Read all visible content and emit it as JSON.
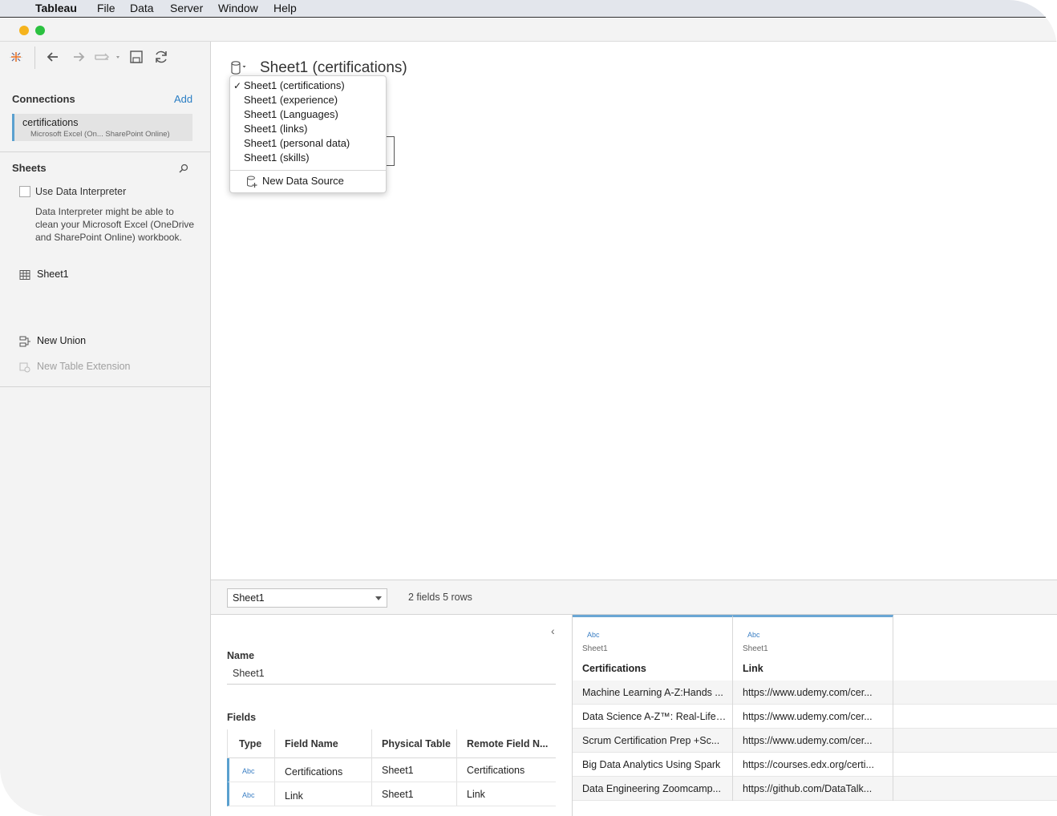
{
  "menubar": {
    "app_name": "Tableau",
    "items": [
      "File",
      "Data",
      "Server",
      "Window",
      "Help"
    ]
  },
  "colors": {
    "accent": "#5aa0cf",
    "link": "#2a7ec4",
    "traffic_yellow": "#f5b31d",
    "traffic_green": "#2bc140"
  },
  "left": {
    "toolbar_icons": [
      "tableau-logo-icon",
      "back-arrow-icon",
      "forward-arrow-icon",
      "redo-icon",
      "save-icon",
      "refresh-icon"
    ],
    "connections_title": "Connections",
    "add_label": "Add",
    "connection": {
      "name": "certifications",
      "type": "Microsoft Excel (On... SharePoint Online)"
    },
    "sheets_title": "Sheets",
    "interpreter_label": "Use Data Interpreter",
    "interpreter_desc": "Data Interpreter might be able to clean your Microsoft Excel (OneDrive and SharePoint Online) workbook.",
    "sheet_name": "Sheet1",
    "new_union": "New Union",
    "new_table_extension": "New Table Extension"
  },
  "canvas": {
    "title": "Sheet1 (certifications)"
  },
  "dropdown": {
    "items": [
      "Sheet1 (certifications)",
      "Sheet1 (experience)",
      "Sheet1 (Languages)",
      "Sheet1 (links)",
      "Sheet1 (personal data)",
      "Sheet1 (skills)"
    ],
    "selected_index": 0,
    "check": "✓",
    "new_data_source": "New Data Source"
  },
  "bottom": {
    "sheet_select": "Sheet1",
    "fields_rows": "2 fields 5 rows",
    "name_label": "Name",
    "name_value": "Sheet1",
    "fields_label": "Fields",
    "field_headers": [
      "Type",
      "Field Name",
      "Physical Table",
      "Remote Field N..."
    ],
    "fields": [
      {
        "type": "Abc",
        "name": "Certifications",
        "table": "Sheet1",
        "remote": "Certifications"
      },
      {
        "type": "Abc",
        "name": "Link",
        "table": "Sheet1",
        "remote": "Link"
      }
    ]
  },
  "grid": {
    "columns": [
      {
        "type": "Abc",
        "source": "Sheet1",
        "name": "Certifications"
      },
      {
        "type": "Abc",
        "source": "Sheet1",
        "name": "Link"
      }
    ],
    "rows": [
      [
        "Machine Learning A-Z:Hands ...",
        "https://www.udemy.com/cer..."
      ],
      [
        "Data Science A-Z™: Real-Life ...",
        "https://www.udemy.com/cer..."
      ],
      [
        "Scrum Certification Prep +Sc...",
        "https://www.udemy.com/cer..."
      ],
      [
        "Big Data Analytics Using Spark",
        "https://courses.edx.org/certi..."
      ],
      [
        "Data Engineering Zoomcamp...",
        "https://github.com/DataTalk..."
      ]
    ]
  }
}
